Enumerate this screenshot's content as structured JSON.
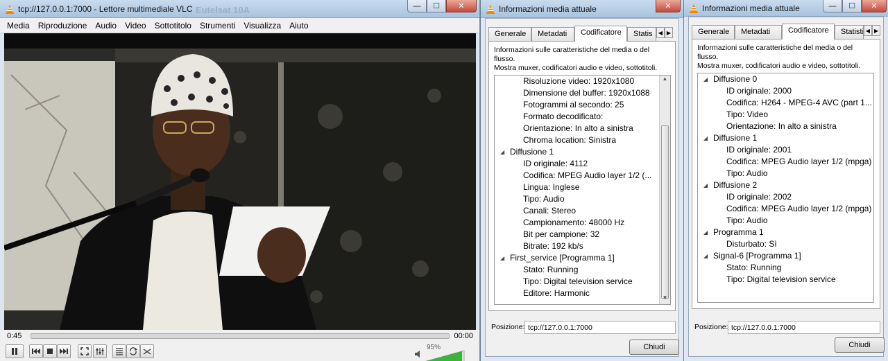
{
  "vlc": {
    "title": "tcp://127.0.0.1:7000 - Lettore multimediale VLC",
    "menu": [
      "Media",
      "Riproduzione",
      "Audio",
      "Video",
      "Sottotitolo",
      "Strumenti",
      "Visualizza",
      "Aiuto"
    ],
    "time_elapsed": "0:45",
    "time_total": "00:00",
    "volume_label": "95%",
    "volume_level": 0.95,
    "seek_progress": 0,
    "overlay_text": "Eutelsat 10A"
  },
  "dialog1": {
    "title": "Informazioni media attuale",
    "tabs": [
      "Generale",
      "Metadati",
      "Codificatore",
      "Statis"
    ],
    "active_tab": "Codificatore",
    "desc_line1": "Informazioni sulle caratteristiche del media o del",
    "desc_line2": "flusso.",
    "desc_line3": "Mostra muxer, codificatori audio e video, sottotitoli.",
    "tree": [
      {
        "level": 2,
        "text": "Risoluzione video: 1920x1080"
      },
      {
        "level": 2,
        "text": "Dimensione del buffer: 1920x1088"
      },
      {
        "level": 2,
        "text": "Fotogrammi al secondo: 25"
      },
      {
        "level": 2,
        "text": "Formato decodificato:"
      },
      {
        "level": 2,
        "text": "Orientazione: In alto a sinistra"
      },
      {
        "level": 2,
        "text": "Chroma location: Sinistra"
      },
      {
        "level": 1,
        "text": "Diffusione 1"
      },
      {
        "level": 2,
        "text": "ID originale: 4112"
      },
      {
        "level": 2,
        "text": "Codifica: MPEG Audio layer 1/2 (..."
      },
      {
        "level": 2,
        "text": "Lingua: Inglese"
      },
      {
        "level": 2,
        "text": "Tipo: Audio"
      },
      {
        "level": 2,
        "text": "Canali: Stereo"
      },
      {
        "level": 2,
        "text": "Campionamento: 48000 Hz"
      },
      {
        "level": 2,
        "text": "Bit per campione: 32"
      },
      {
        "level": 2,
        "text": "Bitrate: 192 kb/s"
      },
      {
        "level": 1,
        "text": "First_service [Programma 1]"
      },
      {
        "level": 2,
        "text": "Stato: Running"
      },
      {
        "level": 2,
        "text": "Tipo: Digital television service"
      },
      {
        "level": 2,
        "text": "Editore: Harmonic"
      }
    ],
    "position_label": "Posizione:",
    "position_value": "tcp://127.0.0.1:7000",
    "close_label": "Chiudi"
  },
  "dialog2": {
    "title": "Informazioni media attuale",
    "tabs": [
      "Generale",
      "Metadati",
      "Codificatore",
      "Statisti"
    ],
    "active_tab": "Codificatore",
    "desc_line1": "Informazioni sulle caratteristiche del media o del",
    "desc_line2": "flusso.",
    "desc_line3": "Mostra muxer, codificatori audio e video, sottotitoli.",
    "tree": [
      {
        "level": 1,
        "text": "Diffusione 0"
      },
      {
        "level": 2,
        "text": "ID originale: 2000"
      },
      {
        "level": 2,
        "text": "Codifica: H264 - MPEG-4 AVC (part 1..."
      },
      {
        "level": 2,
        "text": "Tipo: Video"
      },
      {
        "level": 2,
        "text": "Orientazione: In alto a sinistra"
      },
      {
        "level": 1,
        "text": "Diffusione 1"
      },
      {
        "level": 2,
        "text": "ID originale: 2001"
      },
      {
        "level": 2,
        "text": "Codifica: MPEG Audio layer 1/2 (mpga)"
      },
      {
        "level": 2,
        "text": "Tipo: Audio"
      },
      {
        "level": 1,
        "text": "Diffusione 2"
      },
      {
        "level": 2,
        "text": "ID originale: 2002"
      },
      {
        "level": 2,
        "text": "Codifica: MPEG Audio layer 1/2 (mpga)"
      },
      {
        "level": 2,
        "text": "Tipo: Audio"
      },
      {
        "level": 1,
        "text": "Programma 1"
      },
      {
        "level": 2,
        "text": "Disturbato: Sì"
      },
      {
        "level": 1,
        "text": "Signal-6 [Programma 1]"
      },
      {
        "level": 2,
        "text": "Stato: Running"
      },
      {
        "level": 2,
        "text": "Tipo: Digital television service"
      }
    ],
    "position_label": "Posizione:",
    "position_value": "tcp://127.0.0.1:7000",
    "close_label": "Chiudi"
  },
  "colors": {
    "vlc_orange": "#f08a00",
    "volume_green": "#3cb43c",
    "titlebar": "#b9cfe6",
    "close_red": "#c6483a"
  }
}
